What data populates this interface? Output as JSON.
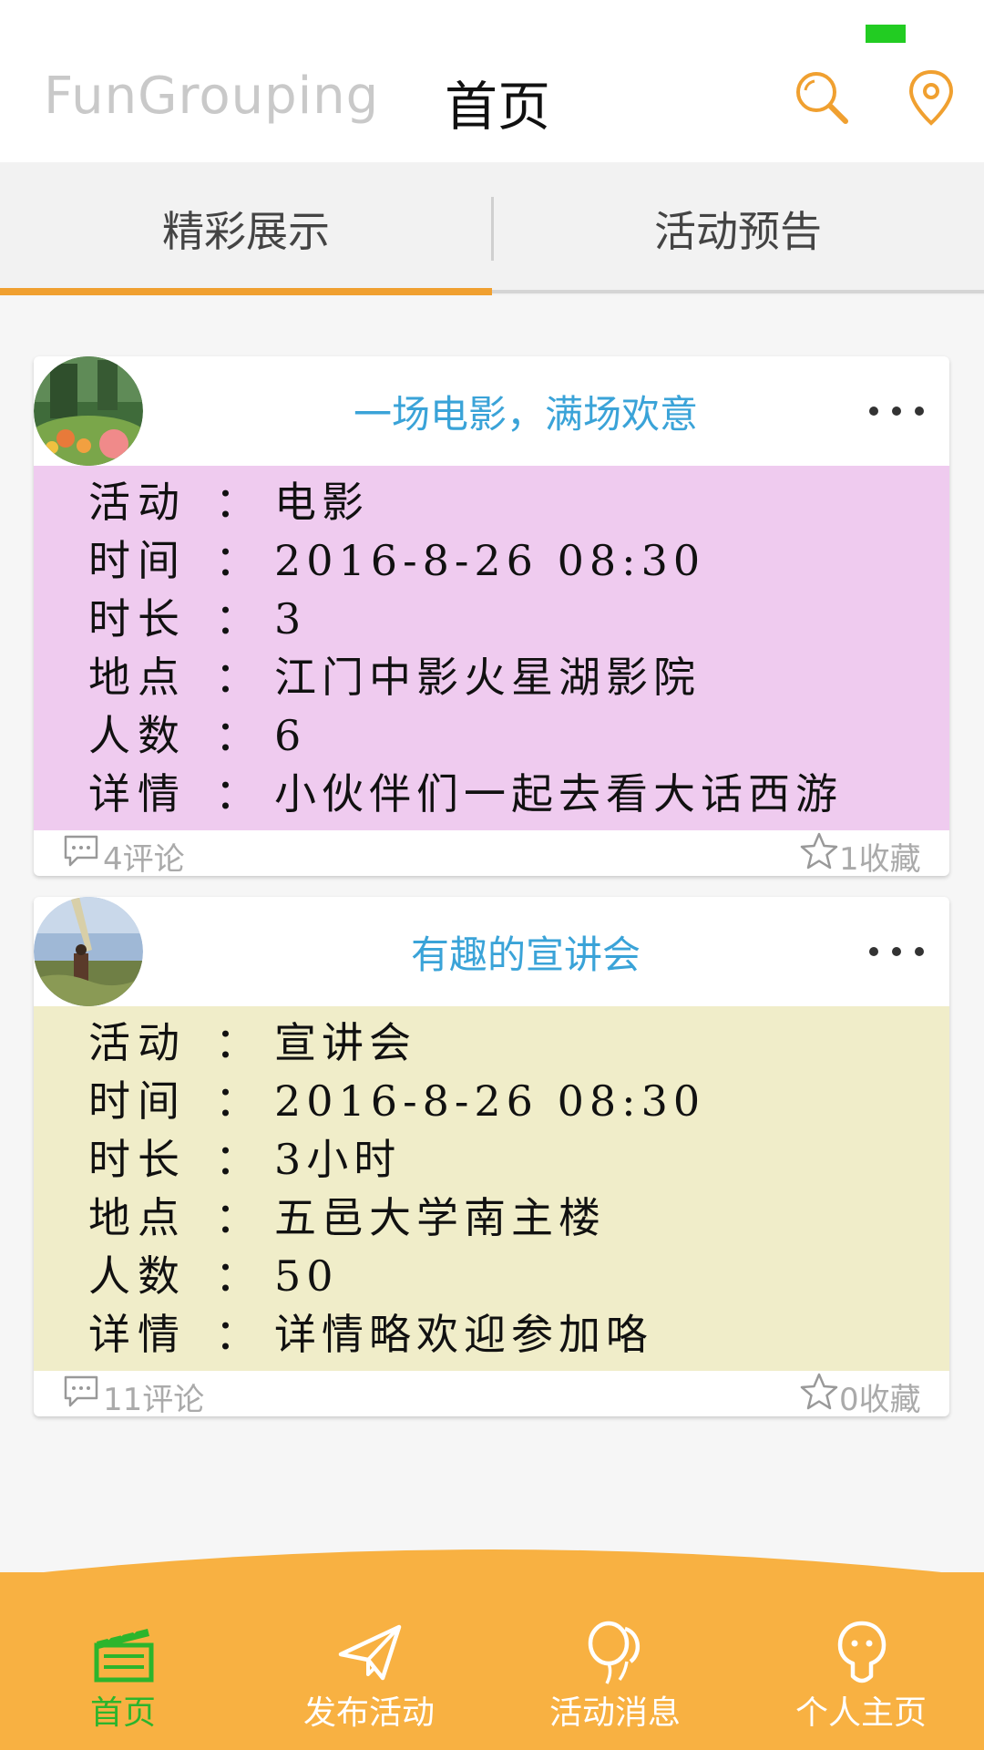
{
  "app": {
    "title": "FunGrouping",
    "page_title": "首页"
  },
  "topbar_icons": [
    "search-icon",
    "location-icon"
  ],
  "colors": {
    "accent": "#f0a030",
    "nav_bg": "#f8b142",
    "active": "#2cb52c",
    "card_title": "#3aa3d8"
  },
  "tabs": [
    {
      "label": "精彩展示",
      "active": true
    },
    {
      "label": "活动预告",
      "active": false
    }
  ],
  "cards": [
    {
      "title": "一场电影，满场欢意",
      "bg": "#efcbef",
      "rows": [
        {
          "label": "活动",
          "value": "电影"
        },
        {
          "label": "时间",
          "value": "2016-8-26 08:30"
        },
        {
          "label": "时长",
          "value": "3"
        },
        {
          "label": "地点",
          "value": "江门中影火星湖影院"
        },
        {
          "label": "人数",
          "value": "6"
        },
        {
          "label": "详情",
          "value": "小伙伴们一起去看大话西游"
        }
      ],
      "comments": "4评论",
      "favorites": "1收藏"
    },
    {
      "title": "有趣的宣讲会",
      "bg": "#f0edc9",
      "rows": [
        {
          "label": "活动",
          "value": "宣讲会"
        },
        {
          "label": "时间",
          "value": "2016-8-26 08:30"
        },
        {
          "label": "时长",
          "value": "3小时"
        },
        {
          "label": "地点",
          "value": "五邑大学南主楼"
        },
        {
          "label": "人数",
          "value": "50"
        },
        {
          "label": "详情",
          "value": "详情略欢迎参加咯"
        }
      ],
      "comments": "11评论",
      "favorites": "0收藏"
    }
  ],
  "nav": [
    {
      "label": "首页",
      "icon": "clapperboard-icon",
      "active": true
    },
    {
      "label": "发布活动",
      "icon": "paper-plane-icon",
      "active": false
    },
    {
      "label": "活动消息",
      "icon": "balloons-icon",
      "active": false
    },
    {
      "label": "个人主页",
      "icon": "person-icon",
      "active": false
    }
  ],
  "separator": "："
}
